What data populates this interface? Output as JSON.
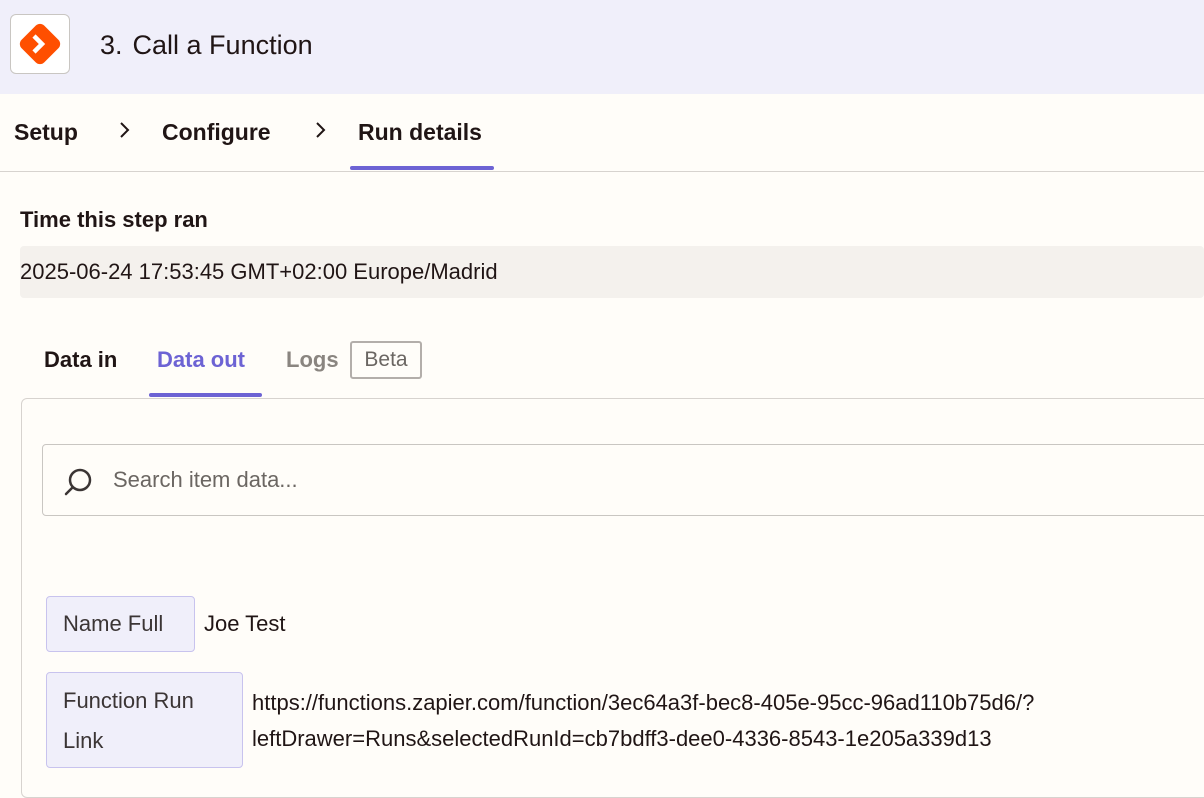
{
  "header": {
    "step_number": "3.",
    "step_title": "Call a Function",
    "app_icon": "zapier-functions-icon",
    "accent_color": "#ff4f00"
  },
  "wizard": {
    "steps": [
      {
        "label": "Setup"
      },
      {
        "label": "Configure"
      },
      {
        "label": "Run details"
      }
    ],
    "active_step": "Run details",
    "accent_color": "#6d63d4"
  },
  "run": {
    "time_label": "Time this step ran",
    "time_value": "2025-06-24 17:53:45 GMT+02:00 Europe/Madrid"
  },
  "data_tabs": {
    "items": [
      {
        "label": "Data in"
      },
      {
        "label": "Data out"
      },
      {
        "label": "Logs"
      }
    ],
    "logs_badge": "Beta",
    "active_tab": "Data out"
  },
  "search": {
    "placeholder": "Search item data...",
    "value": ""
  },
  "fields": [
    {
      "key": "Name Full",
      "value": "Joe Test"
    },
    {
      "key": "Function Run\nLink",
      "value": "https://functions.zapier.com/function/3ec64a3f-bec8-405e-95cc-96ad110b75d6/?\nleftDrawer=Runs&selectedRunId=cb7bdff3-dee0-4336-8543-1e205a339d13"
    }
  ]
}
